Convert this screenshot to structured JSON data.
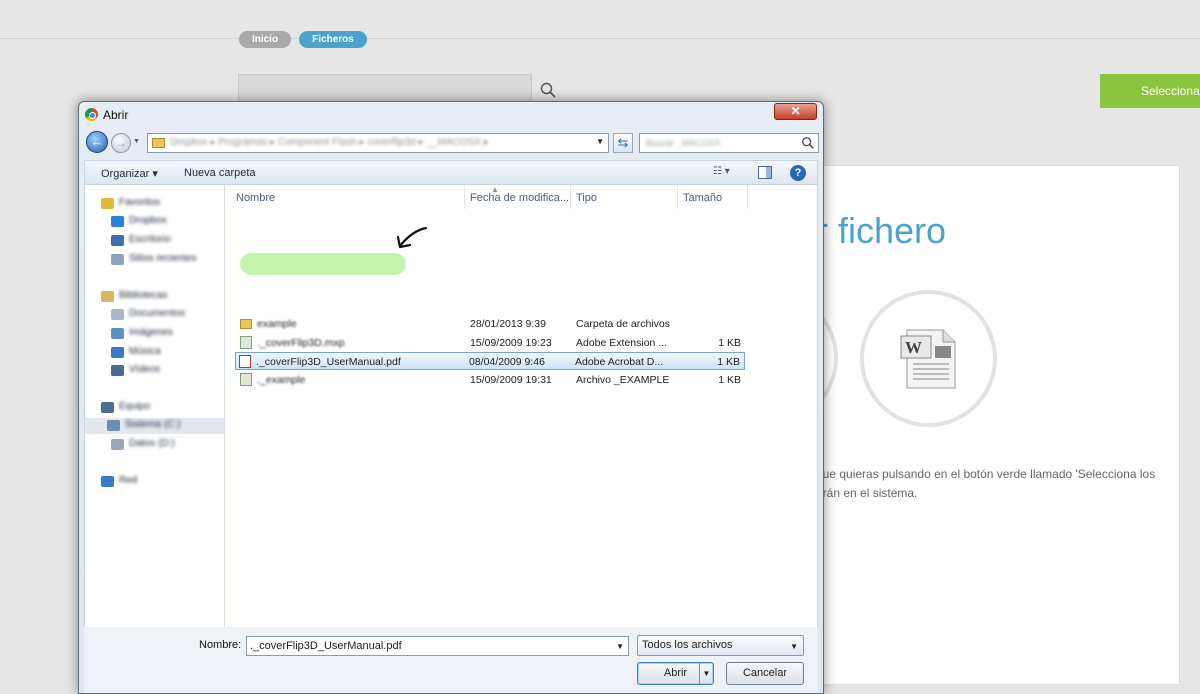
{
  "page": {
    "breadcrumbs": [
      "Inicio",
      "Ficheros"
    ],
    "select_button": "Selecciona",
    "panel_title": "r fichero",
    "panel_text": "que quieras pulsando en el botón verde llamado 'Selecciona los arán en el sistema."
  },
  "dialog": {
    "title": "Abrir",
    "close_glyph": "✕",
    "path_text": "Dropbox ▸ Programas ▸ Component Flash ▸ coverflip3d ▸ __MACOSX ▸",
    "search_placeholder": "Buscar _MACOSX",
    "toolbar": {
      "organize": "Organizar ▾",
      "new_folder": "Nueva carpeta",
      "views_glyph": "☷ ▾",
      "help_glyph": "?"
    },
    "nav": [
      {
        "label": "Favoritos",
        "color": "#e3b93b"
      },
      {
        "label": "Dropbox",
        "color": "#2c82d8"
      },
      {
        "label": "Escritorio",
        "color": "#3b6fb0"
      },
      {
        "label": "Sitios recientes",
        "color": "#8da3bd"
      },
      {
        "label": "Bibliotecas",
        "color": "#d8b760"
      },
      {
        "label": "Documentos",
        "color": "#a9b7c8"
      },
      {
        "label": "Imágenes",
        "color": "#5a8fc4"
      },
      {
        "label": "Música",
        "color": "#3a7bc8"
      },
      {
        "label": "Vídeos",
        "color": "#486a8f"
      },
      {
        "label": "Equipo",
        "color": "#4a6d95"
      },
      {
        "label": "Sistema (C:)",
        "color": "#6c8db3"
      },
      {
        "label": "Datos (D:)",
        "color": "#9aa8b8"
      },
      {
        "label": "Red",
        "color": "#3a7bc8"
      }
    ],
    "columns": {
      "name": "Nombre",
      "date": "Fecha de modifica...",
      "type": "Tipo",
      "size": "Tamaño"
    },
    "files": [
      {
        "name": "example",
        "date": "28/01/2013 9:39",
        "type": "Carpeta de archivos",
        "size": ""
      },
      {
        "name": "._coverFlip3D.mxp",
        "date": "15/09/2009 19:23",
        "type": "Adobe Extension ...",
        "size": "1 KB"
      },
      {
        "name": "._coverFlip3D_UserManual.pdf",
        "date": "08/04/2009 9:46",
        "type": "Adobe Acrobat D...",
        "size": "1 KB"
      },
      {
        "name": "._example",
        "date": "15/09/2009 19:31",
        "type": "Archivo _EXAMPLE",
        "size": "1 KB"
      }
    ],
    "filename_label": "Nombre:",
    "filename_value": "._coverFlip3D_UserManual.pdf",
    "filter_value": "Todos los archivos",
    "open_label": "Abrir",
    "cancel_label": "Cancelar",
    "dropdown_glyph": "▼"
  },
  "colors": {
    "accent_blue": "#4aa3cc",
    "green_button": "#8cc63f",
    "selection_blue": "#cbe3fb"
  }
}
